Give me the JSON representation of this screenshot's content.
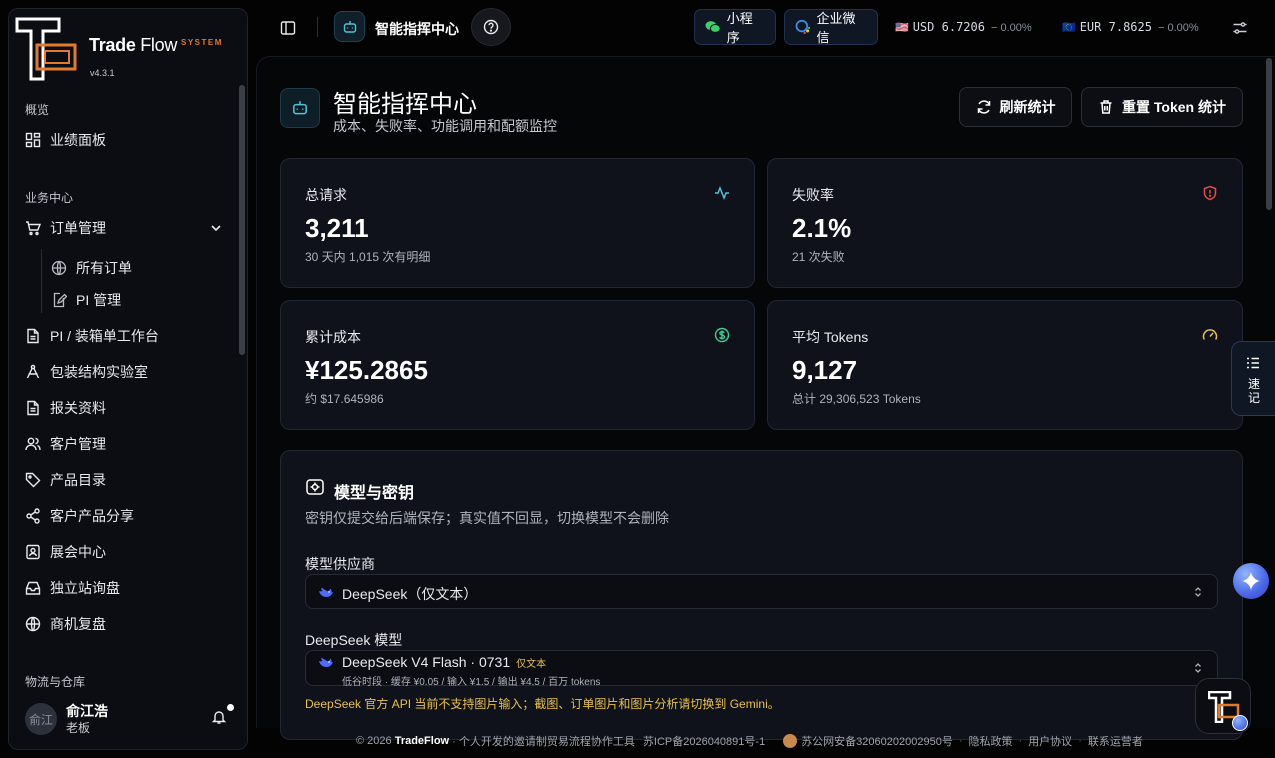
{
  "brand": {
    "name_bold": "Trade",
    "name_light": "Flow",
    "system": "SYSTEM",
    "version": "v4.3.1"
  },
  "sidebar": {
    "sections": [
      "概览",
      "业务中心",
      "物流与仓库"
    ],
    "items": [
      {
        "label": "业绩面板",
        "icon": "dashboard-icon"
      },
      {
        "label": "订单管理",
        "icon": "cart-icon"
      },
      {
        "label": "所有订单",
        "icon": "globe-icon"
      },
      {
        "label": "PI 管理",
        "icon": "edit-doc-icon"
      },
      {
        "label": "PI / 装箱单工作台",
        "icon": "document-icon"
      },
      {
        "label": "包装结构实验室",
        "icon": "compass-icon"
      },
      {
        "label": "报关资料",
        "icon": "document-icon"
      },
      {
        "label": "客户管理",
        "icon": "users-icon"
      },
      {
        "label": "产品目录",
        "icon": "tag-icon"
      },
      {
        "label": "客户产品分享",
        "icon": "share-icon"
      },
      {
        "label": "展会中心",
        "icon": "badge-icon"
      },
      {
        "label": "独立站询盘",
        "icon": "inbox-icon"
      },
      {
        "label": "商机复盘",
        "icon": "globe-icon"
      }
    ],
    "user": {
      "avatar_text": "俞江",
      "name": "俞江浩",
      "role": "老板"
    }
  },
  "header": {
    "title": "智能指挥中心",
    "pill_miniapp": "小程序",
    "pill_wecom": "企业微信",
    "fx": [
      {
        "flag": "🇺🇸",
        "code": "USD",
        "rate": "6.7206",
        "change": "− 0.00%"
      },
      {
        "flag": "🇪🇺",
        "code": "EUR",
        "rate": "7.8625",
        "change": "− 0.00%"
      }
    ]
  },
  "page": {
    "title": "智能指挥中心",
    "subtitle": "成本、失败率、功能调用和配额监控",
    "refresh_label": "刷新统计",
    "reset_label": "重置 Token 统计"
  },
  "stats": [
    {
      "label": "总请求",
      "value": "3,211",
      "note": "30 天内 1,015 次有明细",
      "icon": "activity-icon",
      "color": "#4fc3d9"
    },
    {
      "label": "失败率",
      "value": "2.1%",
      "note": "21 次失败",
      "icon": "shield-alert-icon",
      "color": "#e0504a"
    },
    {
      "label": "累计成本",
      "value": "¥125.2865",
      "note": "约 $17.645986",
      "icon": "dollar-icon",
      "color": "#3ecf8e"
    },
    {
      "label": "平均 Tokens",
      "value": "9,127",
      "note": "总计 29,306,523 Tokens",
      "icon": "gauge-icon",
      "color": "#e8c14a"
    }
  ],
  "model_panel": {
    "title": "模型与密钥",
    "desc": "密钥仅提交给后端保存；真实值不回显，切换模型不会删除",
    "provider_label": "模型供应商",
    "provider_value": "DeepSeek（仅文本）",
    "model_label": "DeepSeek 模型",
    "model_value": "DeepSeek V4 Flash · 0731",
    "model_tag": "仅文本",
    "model_sub": "低谷时段 · 缓存 ¥0.05 / 输入 ¥1.5 / 输出 ¥4.5 / 百万 tokens",
    "warning": "DeepSeek 官方 API 当前不支持图片输入；截图、订单图片和图片分析请切换到 Gemini。"
  },
  "footer": {
    "copyright": "© 2026",
    "brand": "TradeFlow",
    "tagline": "· 个人开发的邀请制贸易流程协作工具",
    "icp": "苏ICP备2026040891号-1",
    "police": "苏公网安备32060202002950号",
    "privacy": "隐私政策",
    "terms": "用户协议",
    "operator": "联系运营者"
  },
  "quicknote": {
    "label": "速记"
  }
}
